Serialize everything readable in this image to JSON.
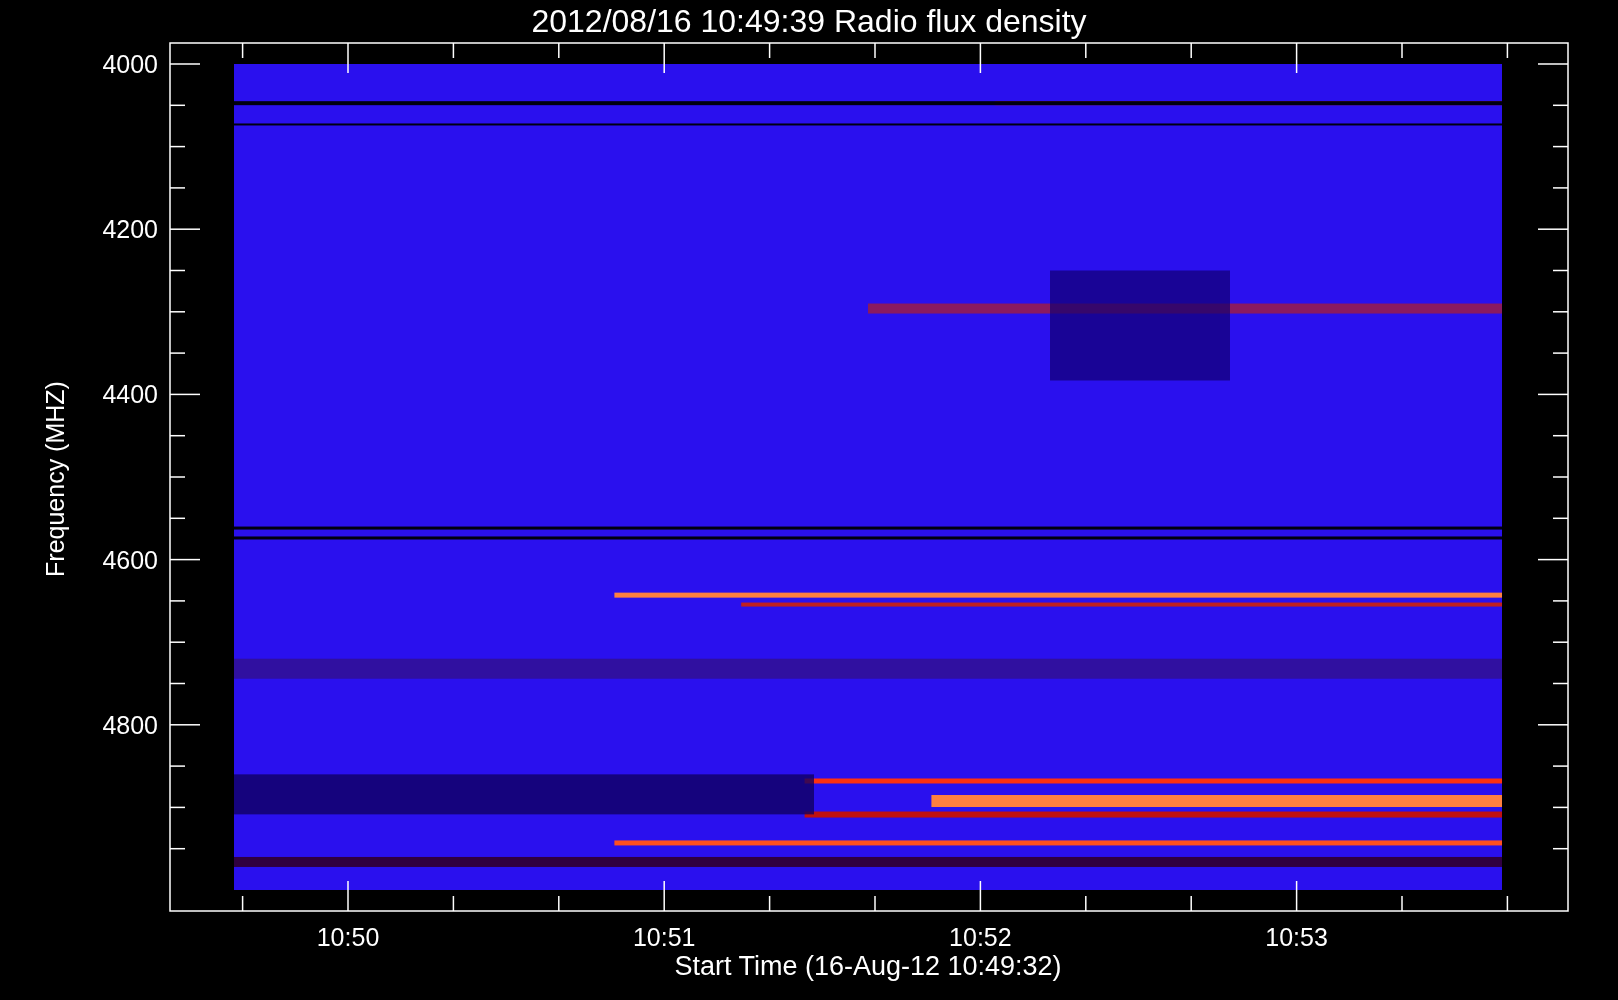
{
  "plot": {
    "title": "2012/08/16 10:49:39 Radio flux density",
    "ylabel": "Frequency (MHZ)",
    "xlabel": "Start Time (16-Aug-12 10:49:32)",
    "ytick_labels": [
      "4000",
      "4200",
      "4400",
      "4600",
      "4800"
    ],
    "xtick_labels": [
      "10:50",
      "10:51",
      "10:52",
      "10:53"
    ]
  }
}
